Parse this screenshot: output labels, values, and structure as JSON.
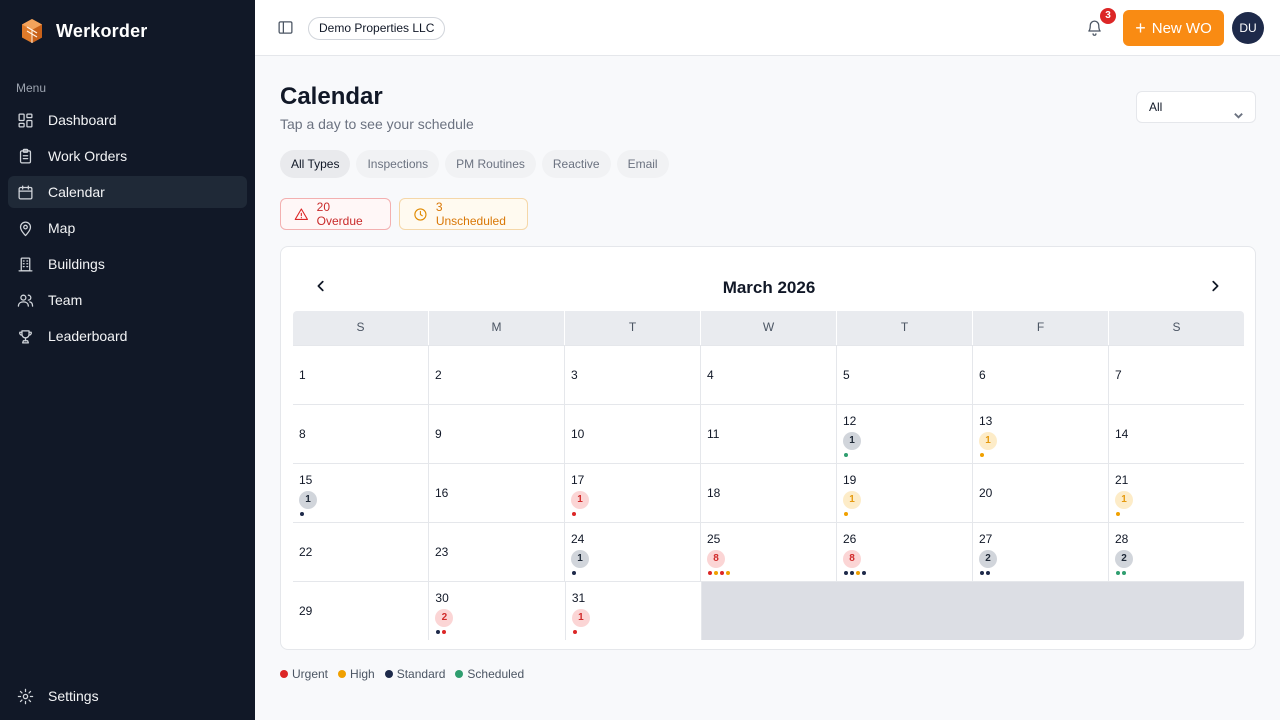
{
  "app": {
    "name": "Werkorder"
  },
  "colors": {
    "urgent": "#dc2626",
    "high": "#f0a000",
    "standard": "#1e2a4a",
    "scheduled": "#2f9e6f",
    "accent": "#f98b13"
  },
  "sidebar": {
    "menu_label": "Menu",
    "items": [
      {
        "label": "Dashboard",
        "icon": "dashboard-icon",
        "active": false
      },
      {
        "label": "Work Orders",
        "icon": "clipboard-icon",
        "active": false
      },
      {
        "label": "Calendar",
        "icon": "calendar-icon",
        "active": true
      },
      {
        "label": "Map",
        "icon": "map-pin-icon",
        "active": false
      },
      {
        "label": "Buildings",
        "icon": "building-icon",
        "active": false
      },
      {
        "label": "Team",
        "icon": "team-icon",
        "active": false
      },
      {
        "label": "Leaderboard",
        "icon": "trophy-icon",
        "active": false
      }
    ],
    "settings_label": "Settings"
  },
  "header": {
    "org": "Demo Properties LLC",
    "notifications": "3",
    "new_wo": "New WO",
    "avatar": "DU"
  },
  "page": {
    "title": "Calendar",
    "subtitle": "Tap a day to see your schedule",
    "filter_value": "All",
    "type_tabs": [
      "All Types",
      "Inspections",
      "PM Routines",
      "Reactive",
      "Email"
    ],
    "active_tab": 0,
    "overdue": "20 Overdue",
    "unscheduled": "3 Unscheduled"
  },
  "calendar": {
    "month_label": "March 2026",
    "weekdays": [
      "S",
      "M",
      "T",
      "W",
      "T",
      "F",
      "S"
    ],
    "weeks": [
      [
        {
          "d": "1"
        },
        {
          "d": "2"
        },
        {
          "d": "3"
        },
        {
          "d": "4"
        },
        {
          "d": "5"
        },
        {
          "d": "6"
        },
        {
          "d": "7"
        }
      ],
      [
        {
          "d": "8"
        },
        {
          "d": "9"
        },
        {
          "d": "10"
        },
        {
          "d": "11"
        },
        {
          "d": "12",
          "count": "1",
          "tone": "gray",
          "dots": [
            "scheduled"
          ]
        },
        {
          "d": "13",
          "count": "1",
          "tone": "yellow",
          "dots": [
            "high"
          ]
        },
        {
          "d": "14"
        }
      ],
      [
        {
          "d": "15",
          "count": "1",
          "tone": "gray",
          "dots": [
            "standard"
          ]
        },
        {
          "d": "16"
        },
        {
          "d": "17",
          "count": "1",
          "tone": "red",
          "dots": [
            "urgent"
          ]
        },
        {
          "d": "18"
        },
        {
          "d": "19",
          "count": "1",
          "tone": "yellow",
          "dots": [
            "high"
          ]
        },
        {
          "d": "20"
        },
        {
          "d": "21",
          "count": "1",
          "tone": "yellow",
          "dots": [
            "high"
          ]
        }
      ],
      [
        {
          "d": "22"
        },
        {
          "d": "23"
        },
        {
          "d": "24",
          "count": "1",
          "tone": "gray",
          "dots": [
            "standard"
          ]
        },
        {
          "d": "25",
          "count": "8",
          "tone": "red",
          "dots": [
            "urgent",
            "high",
            "urgent",
            "high"
          ]
        },
        {
          "d": "26",
          "count": "8",
          "tone": "red",
          "dots": [
            "standard",
            "standard",
            "high",
            "standard"
          ]
        },
        {
          "d": "27",
          "count": "2",
          "tone": "gray",
          "dots": [
            "standard",
            "standard"
          ]
        },
        {
          "d": "28",
          "count": "2",
          "tone": "gray",
          "dots": [
            "scheduled",
            "scheduled"
          ]
        }
      ],
      [
        {
          "d": "29"
        },
        {
          "d": "30",
          "count": "2",
          "tone": "red",
          "dots": [
            "standard",
            "urgent"
          ]
        },
        {
          "d": "31",
          "count": "1",
          "tone": "red",
          "dots": [
            "urgent"
          ]
        },
        {
          "blank": true
        },
        {
          "blank": true
        },
        {
          "blank": true
        },
        {
          "blank": true
        }
      ]
    ]
  },
  "legend": [
    {
      "label": "Urgent",
      "key": "urgent"
    },
    {
      "label": "High",
      "key": "high"
    },
    {
      "label": "Standard",
      "key": "standard"
    },
    {
      "label": "Scheduled",
      "key": "scheduled"
    }
  ]
}
